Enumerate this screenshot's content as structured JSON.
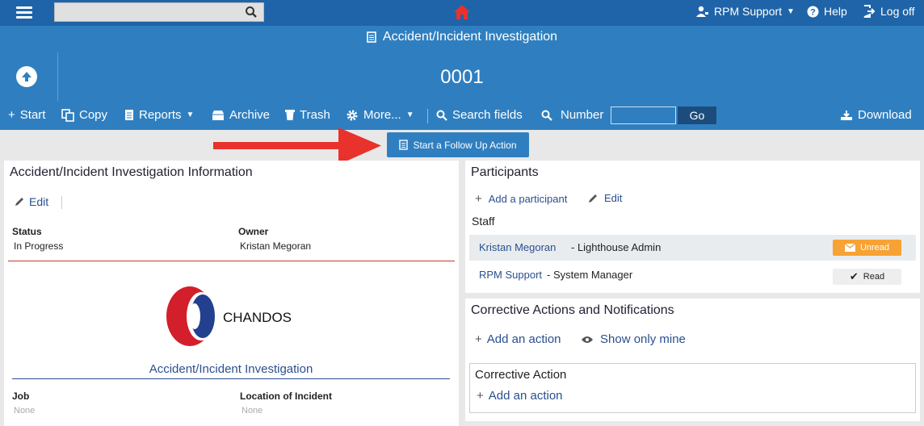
{
  "topbar": {
    "search": {
      "placeholder": "",
      "value": ""
    },
    "user_menu": "RPM Support",
    "help": "Help",
    "logoff": "Log off"
  },
  "header": {
    "doc_title": "Accident/Incident Investigation",
    "record_number": "0001"
  },
  "toolbar": {
    "start": "Start",
    "copy": "Copy",
    "reports": "Reports",
    "archive": "Archive",
    "trash": "Trash",
    "more": "More...",
    "search_fields": "Search fields",
    "number": "Number",
    "number_value": "",
    "go": "Go",
    "download": "Download"
  },
  "followup_button": "Start a Follow Up Action",
  "info_panel": {
    "title": "Accident/Incident Investigation Information",
    "edit": "Edit",
    "status_label": "Status",
    "status_value": "In Progress",
    "owner_label": "Owner",
    "owner_value": "Kristan Megoran",
    "logo_text": "CHANDOS",
    "form_title": "Accident/Incident Investigation",
    "job_label": "Job",
    "job_value": "None",
    "location_label": "Location of Incident",
    "location_value": "None"
  },
  "participants": {
    "title": "Participants",
    "add": "Add a participant",
    "edit": "Edit",
    "staff_heading": "Staff",
    "rows": [
      {
        "name": "Kristan Megoran",
        "role": "- Lighthouse Admin",
        "status": "Unread"
      },
      {
        "name": "RPM Support",
        "role": "- System Manager",
        "status": "Read"
      }
    ]
  },
  "corrective": {
    "title": "Corrective Actions and Notifications",
    "add_action": "Add an action",
    "show_mine": "Show only mine",
    "box_title": "Corrective Action",
    "box_add": "Add an action"
  },
  "colors": {
    "topbar": "#1f64a8",
    "header": "#2f7fc0",
    "unread": "#f7a234",
    "arrow": "#e8322b"
  }
}
